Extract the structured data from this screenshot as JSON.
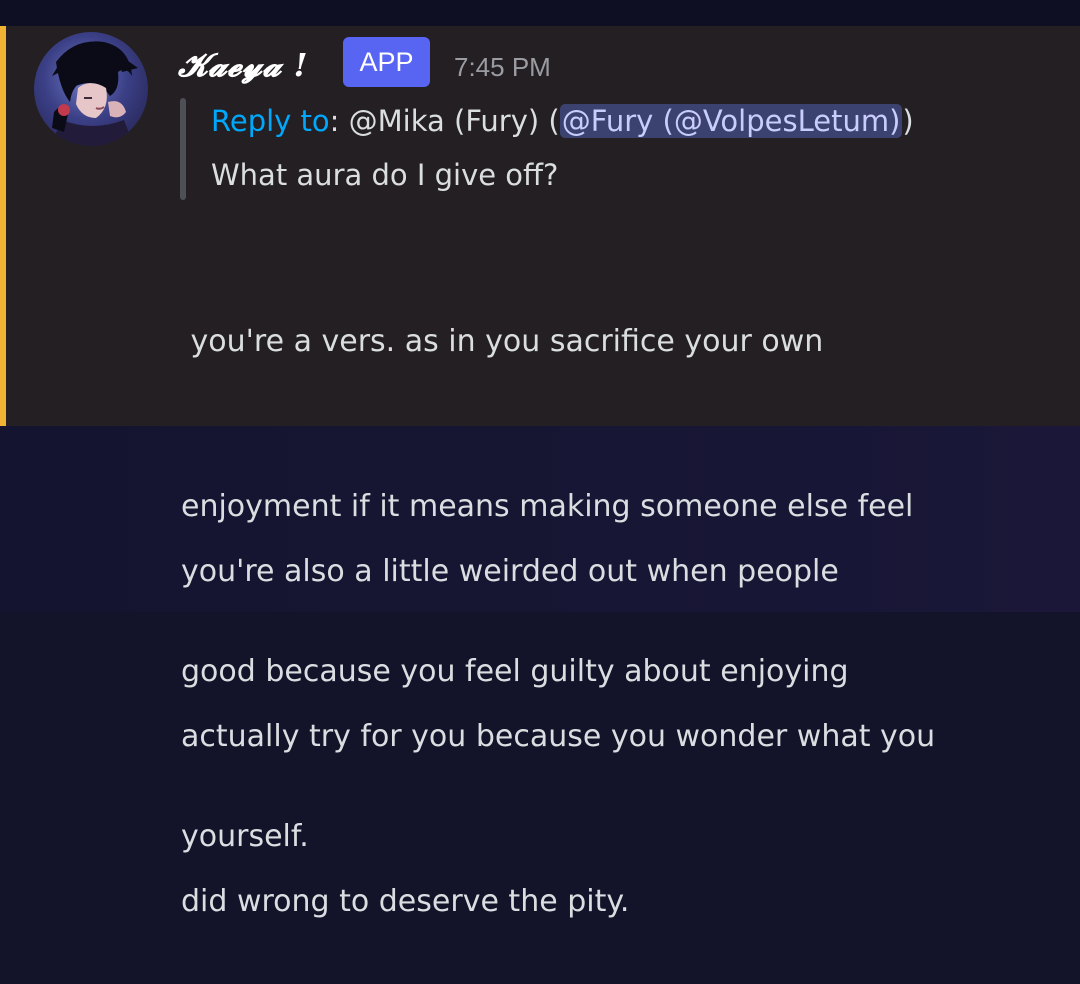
{
  "message": {
    "author": "𝓚𝓪𝓮𝔂𝓪 !",
    "badge": "APP",
    "timestamp": "7:45 PM",
    "reply": {
      "label": "Reply to",
      "separator": ":",
      "target_name": "@Mika (Fury)",
      "open_paren": " (",
      "mention": "@Fury (@VolpesLetum)",
      "close_paren": ")",
      "quoted_text": "What aura do I give off?"
    },
    "paragraph1_lines": [
      " you're a vers. as in you sacrifice your own",
      "enjoyment if it means making someone else feel",
      "good because you feel guilty about enjoying",
      "yourself."
    ],
    "paragraph2_lines": [
      "you're also a little weirded out when people",
      "actually try for you because you wonder what you",
      "did wrong to deserve the pity."
    ]
  },
  "colors": {
    "highlight_background": "#231f22",
    "accent_bar": "#f0b232",
    "app_badge": "#5865f2",
    "reply_link": "#00a8fc",
    "mention_background": "#3c4270"
  }
}
